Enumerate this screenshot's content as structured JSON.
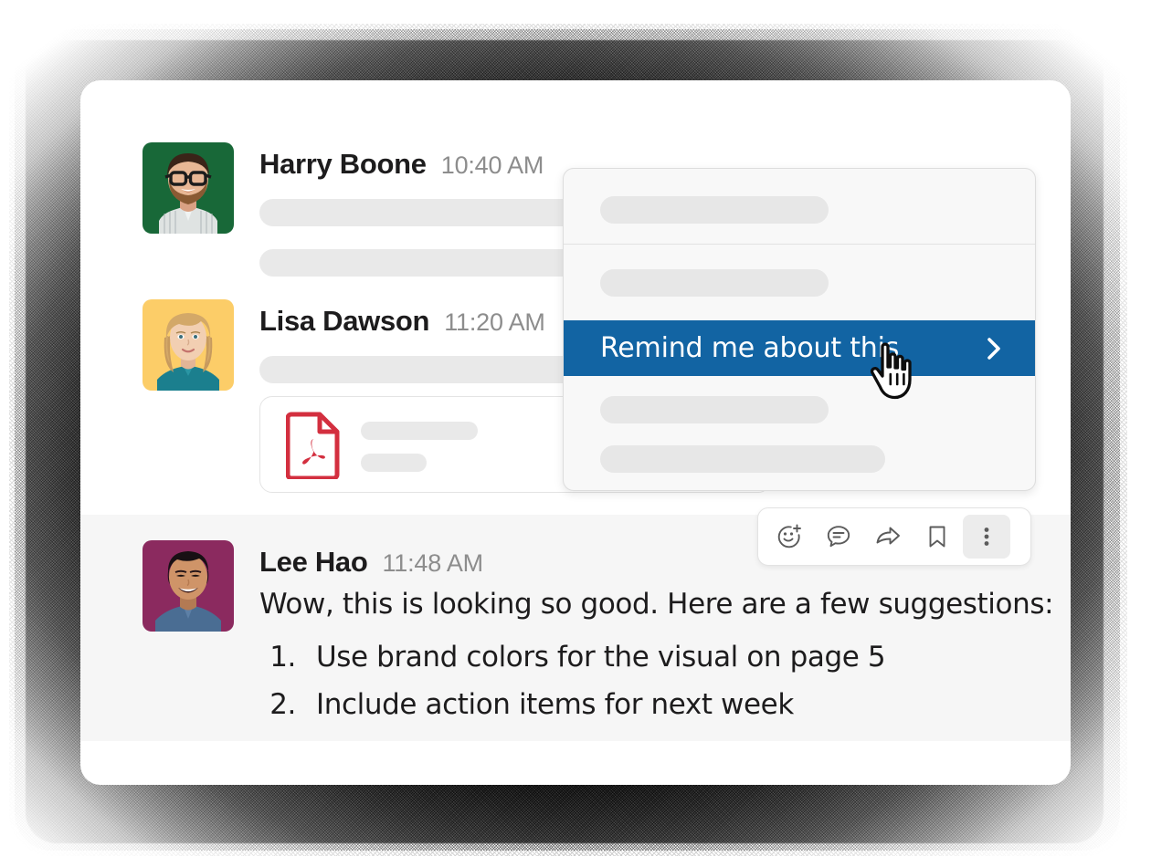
{
  "messages": [
    {
      "id": "harry",
      "author": "Harry Boone",
      "time": "10:40 AM",
      "avatar_bg": "#186838",
      "avatar_name": "avatar-harry-boone",
      "body_type": "skeleton"
    },
    {
      "id": "lisa",
      "author": "Lisa Dawson",
      "time": "11:20 AM",
      "avatar_bg": "#fccd68",
      "avatar_name": "avatar-lisa-dawson",
      "body_type": "skeleton-with-attachment",
      "attachment": {
        "icon": "pdf-file-icon",
        "icon_color": "#d32f3f"
      }
    },
    {
      "id": "lee",
      "author": "Lee Hao",
      "time": "11:48 AM",
      "avatar_bg": "#8b2a5f",
      "avatar_name": "avatar-lee-hao",
      "body_type": "text",
      "text": "Wow, this is looking so good. Here are a few suggestions:",
      "list": [
        {
          "num": "1.",
          "text": "Use brand colors for the visual on page 5"
        },
        {
          "num": "2.",
          "text": "Include action items for next week"
        }
      ]
    }
  ],
  "toolbar": {
    "buttons": [
      {
        "name": "add-reaction-icon",
        "label": "Add reaction",
        "active": false
      },
      {
        "name": "reply-in-thread-icon",
        "label": "Reply in thread",
        "active": false
      },
      {
        "name": "share-message-icon",
        "label": "Share message",
        "active": false
      },
      {
        "name": "save-message-icon",
        "label": "Save for later",
        "active": false
      },
      {
        "name": "more-actions-icon",
        "label": "More actions",
        "active": true
      }
    ]
  },
  "context_menu": {
    "highlighted_item": {
      "label": "Remind me about this",
      "chevron": "chevron-right-icon",
      "bg_color": "#1264a3",
      "text_color": "#ffffff"
    },
    "placeholder_items": 4,
    "background": "#f8f8f8"
  },
  "cursor": {
    "type": "pointing-hand-cursor"
  },
  "colors": {
    "accent_blue": "#1264a3",
    "author_text": "#1d1c1d",
    "timestamp_text": "#8d8d8d",
    "skeleton": "#e9e9e9",
    "highlight_row_bg": "#f6f6f6",
    "card_bg": "#ffffff"
  }
}
